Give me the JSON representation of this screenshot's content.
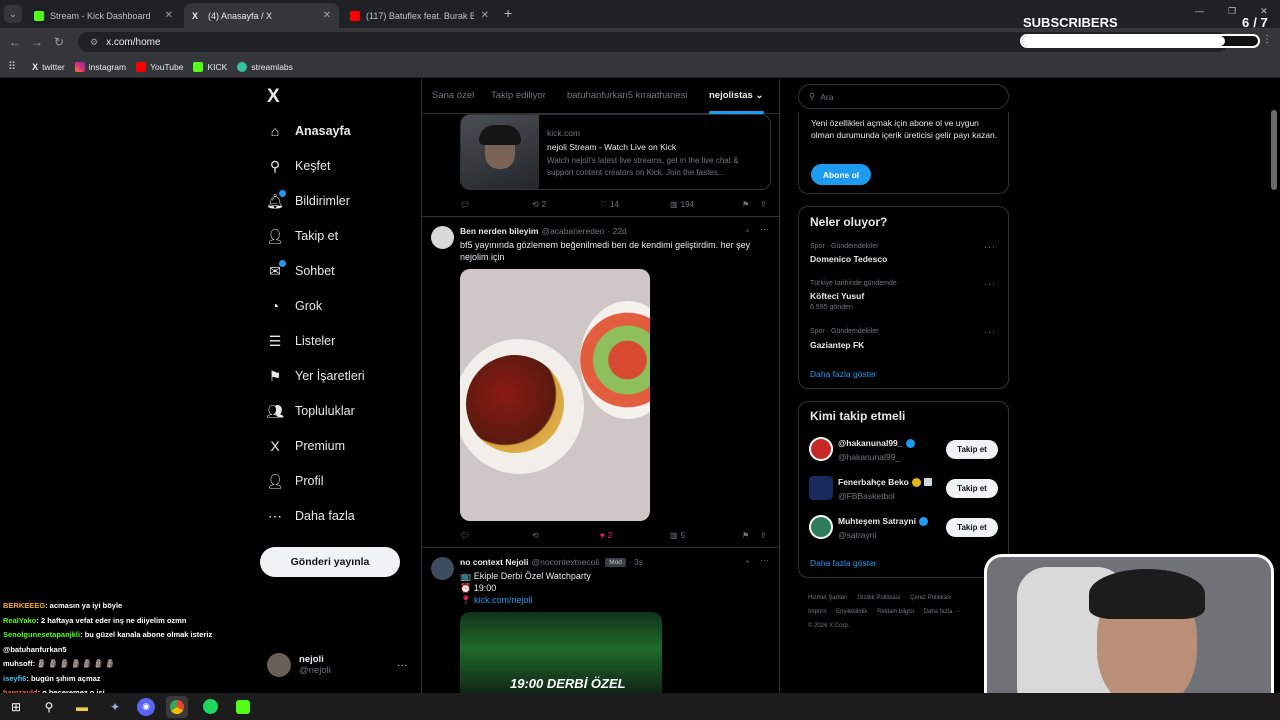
{
  "browser": {
    "tabs": [
      {
        "title": "Stream - Kick Dashboard",
        "favicon_color": "#53fc18"
      },
      {
        "title": "(4) Anasayfa / X",
        "favicon_color": "#e8eaed"
      },
      {
        "title": "(117) Batuflex feat. Burak Balka",
        "favicon_color": "#ff0000"
      }
    ],
    "new_tab_label": "+",
    "url": "x.com/home",
    "bookmarks": [
      "twitter",
      "instagram",
      "YouTube",
      "KICK",
      "streamlabs"
    ]
  },
  "overlay": {
    "subscribers_label": "SUBSCRIBERS",
    "subscribers_count": "6",
    "subscribers_goal": "/ 7",
    "subscribers_progress": 0.86
  },
  "sidebar": {
    "logo": "X",
    "items": [
      {
        "label": "Anasayfa",
        "icon": "home-icon",
        "glyph": "⌂",
        "bold": true
      },
      {
        "label": "Keşfet",
        "icon": "search-icon",
        "glyph": "⚲"
      },
      {
        "label": "Bildirimler",
        "icon": "bell-icon",
        "glyph": "🔔︎",
        "badge": true
      },
      {
        "label": "Takip et",
        "icon": "follow-icon",
        "glyph": "👤︎"
      },
      {
        "label": "Sohbet",
        "icon": "chat-icon",
        "glyph": "✉",
        "badge": true
      },
      {
        "label": "Grok",
        "icon": "grok-icon",
        "glyph": "◔"
      },
      {
        "label": "Listeler",
        "icon": "list-icon",
        "glyph": "☰"
      },
      {
        "label": "Yer İşaretleri",
        "icon": "bookmark-icon",
        "glyph": "⚑"
      },
      {
        "label": "Topluluklar",
        "icon": "communities-icon",
        "glyph": "👥︎"
      },
      {
        "label": "Premium",
        "icon": "x-premium-icon",
        "glyph": "X"
      },
      {
        "label": "Profil",
        "icon": "profile-icon",
        "glyph": "👤︎"
      },
      {
        "label": "Daha fazla",
        "icon": "more-circle-icon",
        "glyph": "⋯"
      }
    ],
    "post_button": "Gönderi yayınla",
    "account": {
      "name": "nejoli",
      "handle": "@nejoli",
      "more": "···"
    }
  },
  "feed": {
    "tabs": [
      "Sana özel",
      "Takip ediliyor",
      "batuhanfurkan5 kıraathanesi",
      "nejolistas"
    ],
    "active_tab": "nejolistas",
    "card": {
      "domain": "kick.com",
      "title": "nejoli Stream - Watch Live on Kick",
      "desc": "Watch nejoli's latest live streams, get in the live chat & support content creators on Kick. Join the fastes..."
    },
    "post1_stats": {
      "reposts": "2",
      "likes": "14",
      "views": "194"
    },
    "post2": {
      "name": "Ben nerden bileyim",
      "handle": "@acabaneredeo",
      "time": "· 22d",
      "text": "bf5 yayınında gözlemem beğenilmedi ben de kendimi geliştirdim. her şey nejolim için",
      "likes": "2",
      "views": "5"
    },
    "post3": {
      "name": "no context Nejoli",
      "handle": "@nocontextnecoli",
      "badge": "Mod",
      "time": "· 3s",
      "line1": "📺 Ekiple Derbi Özel Watchparty",
      "line2": "⏰ 19:00",
      "link": "kick.com/nejoli",
      "image_text": "19:00 DERBİ ÖZEL"
    }
  },
  "right": {
    "search_placeholder": "Ara",
    "premium": {
      "text": "Yeni özellikleri açmak için abone ol ve uygun olman durumunda içerik üreticisi gelir payı kazan.",
      "button": "Abone ol"
    },
    "trends_title": "Neler oluyor?",
    "trends": [
      {
        "meta": "Spor · Gündemdekiler",
        "name": "Domenico Tedesco",
        "count": ""
      },
      {
        "meta": "Türkiye tarihinde gündemde",
        "name": "Köfteci Yusuf",
        "count": "6.595 gönderi"
      },
      {
        "meta": "Spor · Gündemdekiler",
        "name": "Gaziantep FK",
        "count": ""
      }
    ],
    "trends_more": "Daha fazla göster",
    "wtf_title": "Kimi takip etmeli",
    "who_to_follow": [
      {
        "name": "@hakanunal99_",
        "handle": "@hakanunal99_",
        "verified": "blue",
        "avatar_color": "#c62828"
      },
      {
        "name": "Fenerbahçe Beko",
        "handle": "@FBBasketbol",
        "verified": "gold",
        "avatar_color": "#1a2a5c"
      },
      {
        "name": "Muhteşem Satrayni",
        "handle": "@satrayni",
        "verified": "blue",
        "avatar_color": "#2e7d5b"
      }
    ],
    "follow_label": "Takip et",
    "wtf_more": "Daha fazla göster",
    "footer": [
      "Hizmet Şartları",
      "Gizlilik Politikası",
      "Çerez Politikası",
      "Imprint",
      "Erişilebilirlik",
      "Reklam bilgisi",
      "Daha fazla ···",
      "© 2026 X Corp."
    ]
  },
  "chat": [
    {
      "user": "BERKEEEG",
      "color": "#f5a623",
      "msg": ": acmasın ya iyi böyle"
    },
    {
      "user": "RealYako",
      "color": "#53fc18",
      "msg": ": 2 haftaya vefat eder inş ne diiyelim ozmn"
    },
    {
      "user": "Senolgunesetapanjkli",
      "color": "#53fc18",
      "msg": ": bu güzel kanala abone olmak isteriz"
    },
    {
      "user": "",
      "color": "#ffffff",
      "msg": "@batuhanfurkan5"
    },
    {
      "user": "muhsoff",
      "color": "#ffffff",
      "msg": ": 🗿 🗿 🗿 🗿 🗿 🗿 🗿"
    },
    {
      "user": "iseyfi6",
      "color": "#4fc3f7",
      "msg": ": bugün şıhım açmaz"
    },
    {
      "user": "hamzauld",
      "color": "#ff5a5a",
      "msg": ": o beceremez o isi"
    }
  ],
  "taskbar": [
    "windows-icon",
    "search-icon",
    "file-explorer-icon",
    "app-icon",
    "discord-icon",
    "chrome-icon",
    "spotify-icon",
    "kick-icon"
  ]
}
